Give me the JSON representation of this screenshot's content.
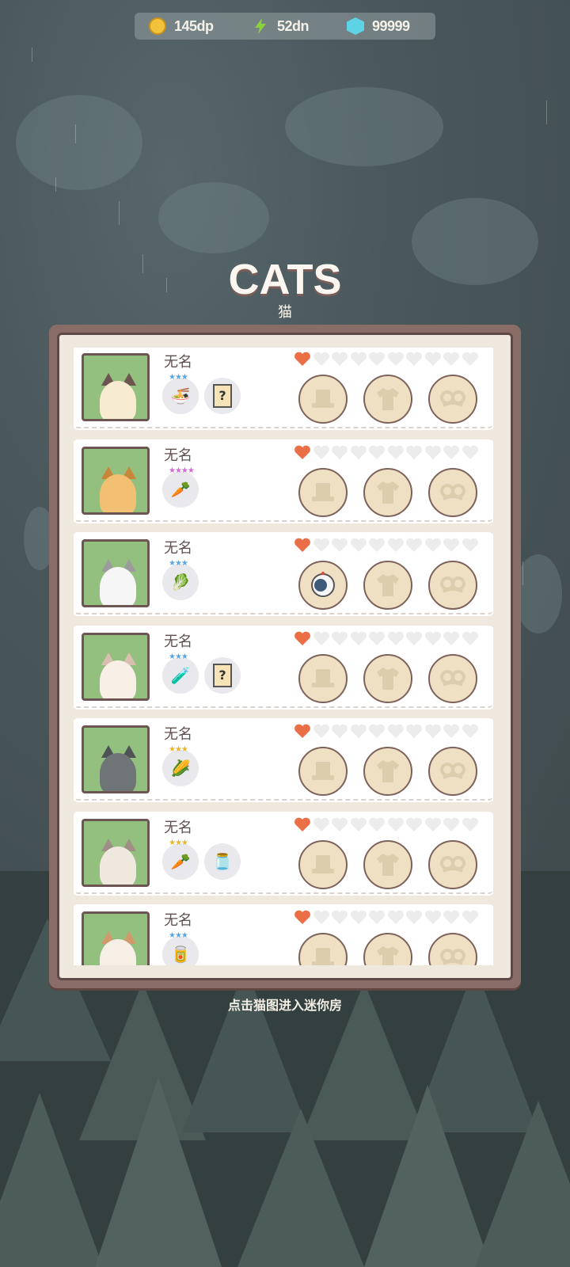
{
  "resources": {
    "coins": "145dp",
    "energy": "52dn",
    "gems": "99999"
  },
  "colors": {
    "heart_filled": "#ea6f47",
    "heart_empty": "#ececec",
    "thumb_bg": "#93c07e",
    "frame": "#8a6d67"
  },
  "title": "CATS",
  "subtitle": "猫",
  "hint": "点击猫图进入迷你房",
  "cats": [
    {
      "name": "无名",
      "hearts_filled": 1,
      "hearts_total": 10,
      "items": [
        {
          "icon": "noodle-bowl-icon",
          "stars": "★★★"
        },
        {
          "icon": "unknown-item-icon",
          "stars": ""
        }
      ],
      "slots": [
        "hat-slot-empty",
        "shirt-slot-empty",
        "glasses-slot-empty"
      ],
      "fur": "siamese"
    },
    {
      "name": "无名",
      "hearts_filled": 1,
      "hearts_total": 10,
      "items": [
        {
          "icon": "carrot-icon",
          "stars": "★★★★"
        }
      ],
      "slots": [
        "hat-slot-empty",
        "shirt-slot-empty",
        "glasses-slot-empty"
      ],
      "fur": "orange-tabby"
    },
    {
      "name": "无名",
      "hearts_filled": 1,
      "hearts_total": 10,
      "items": [
        {
          "icon": "lettuce-icon",
          "stars": "★★★"
        }
      ],
      "slots": [
        "astronaut-helmet-equipped",
        "shirt-slot-empty",
        "glasses-slot-empty"
      ],
      "fur": "astronaut"
    },
    {
      "name": "无名",
      "hearts_filled": 1,
      "hearts_total": 10,
      "items": [
        {
          "icon": "potion-icon",
          "stars": "★★★"
        },
        {
          "icon": "unknown-item-icon",
          "stars": ""
        }
      ],
      "slots": [
        "hat-slot-empty",
        "shirt-slot-empty",
        "glasses-slot-empty"
      ],
      "fur": "cream"
    },
    {
      "name": "无名",
      "hearts_filled": 1,
      "hearts_total": 10,
      "items": [
        {
          "icon": "corn-icon",
          "stars": "★★★"
        }
      ],
      "slots": [
        "hat-slot-empty",
        "shirt-slot-empty",
        "glasses-slot-empty"
      ],
      "fur": "grey"
    },
    {
      "name": "无名",
      "hearts_filled": 1,
      "hearts_total": 10,
      "items": [
        {
          "icon": "carrot-icon",
          "stars": "★★★"
        },
        {
          "icon": "jar-icon",
          "stars": ""
        }
      ],
      "slots": [
        "hat-slot-empty",
        "shirt-slot-empty",
        "glasses-slot-empty"
      ],
      "fur": "tabby"
    },
    {
      "name": "无名",
      "hearts_filled": 1,
      "hearts_total": 10,
      "items": [
        {
          "icon": "food-icon",
          "stars": "★★★"
        }
      ],
      "slots": [
        "hat-slot-empty",
        "shirt-slot-empty",
        "glasses-slot-empty"
      ],
      "fur": "calico"
    }
  ]
}
